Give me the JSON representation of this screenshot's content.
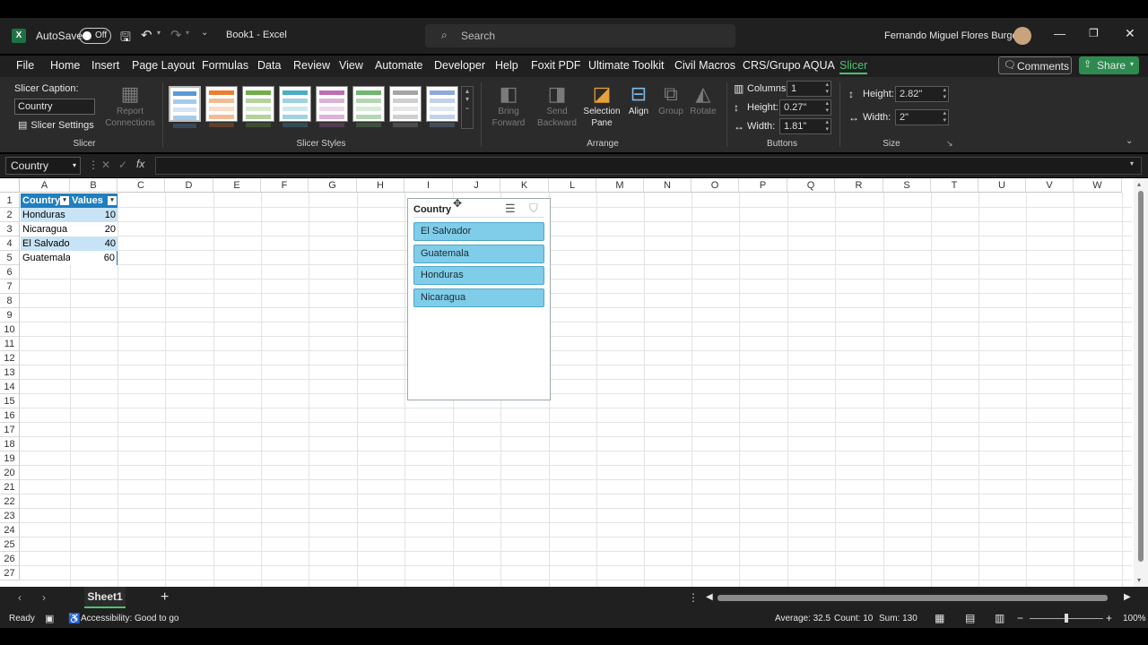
{
  "titlebar": {
    "autosave_label": "AutoSave",
    "autosave_state": "Off",
    "doc_title": "Book1 - Excel",
    "search_placeholder": "Search",
    "user_name": "Fernando Miguel Flores Burgos"
  },
  "menu": [
    "File",
    "Home",
    "Insert",
    "Page Layout",
    "Formulas",
    "Data",
    "Review",
    "View",
    "Automate",
    "Developer",
    "Help",
    "Foxit PDF",
    "Ultimate Toolkit",
    "Civil Macros",
    "CRS/Grupo AQUA",
    "Slicer"
  ],
  "menu_buttons": {
    "comments": "Comments",
    "share": "Share"
  },
  "ribbon": {
    "slicer": {
      "caption_label": "Slicer Caption:",
      "caption_value": "Country",
      "settings_label": "Slicer Settings",
      "report_connections_label": "Report Connections",
      "group_label": "Slicer"
    },
    "styles": {
      "group_label": "Slicer Styles",
      "colors": [
        "#5b9bd5",
        "#ed7d31",
        "#70ad47",
        "#4bacc6",
        "#c06cb6",
        "#6fb66f",
        "#a5a5a5",
        "#8ea9db"
      ]
    },
    "arrange": {
      "bring_forward": "Bring Forward",
      "send_backward": "Send Backward",
      "selection_pane": "Selection Pane",
      "align": "Align",
      "group": "Group",
      "rotate": "Rotate",
      "group_label": "Arrange"
    },
    "buttons": {
      "columns_label": "Columns:",
      "columns_value": "1",
      "height_label": "Height:",
      "height_value": "0.27\"",
      "width_label": "Width:",
      "width_value": "1.81\"",
      "group_label": "Buttons"
    },
    "size": {
      "height_label": "Height:",
      "height_value": "2.82\"",
      "width_label": "Width:",
      "width_value": "2\"",
      "group_label": "Size"
    }
  },
  "formula_bar": {
    "name_box": "Country",
    "fx": "fx",
    "value": ""
  },
  "columns": [
    "A",
    "B",
    "C",
    "D",
    "E",
    "F",
    "G",
    "H",
    "I",
    "J",
    "K",
    "L",
    "M",
    "N",
    "O",
    "P",
    "Q",
    "R",
    "S",
    "T",
    "U",
    "V",
    "W"
  ],
  "rows": [
    "1",
    "2",
    "3",
    "4",
    "5",
    "6",
    "7",
    "8",
    "9",
    "10",
    "11",
    "12",
    "13",
    "14",
    "15",
    "16",
    "17",
    "18",
    "19",
    "20",
    "21",
    "22",
    "23",
    "24",
    "25",
    "26",
    "27"
  ],
  "table": {
    "headers": [
      "Country",
      "Values"
    ],
    "rows": [
      [
        "Honduras",
        "10"
      ],
      [
        "Nicaragua",
        "20"
      ],
      [
        "El Salvador",
        "40"
      ],
      [
        "Guatemala",
        "60"
      ]
    ]
  },
  "slicer_box": {
    "title": "Country",
    "items": [
      "El Salvador",
      "Guatemala",
      "Honduras",
      "Nicaragua"
    ]
  },
  "sheet_tabs": {
    "active": "Sheet1"
  },
  "statusbar": {
    "ready": "Ready",
    "accessibility": "Accessibility: Good to go",
    "average": "Average: 32.5",
    "count": "Count: 10",
    "sum": "Sum: 130",
    "zoom": "100%"
  }
}
